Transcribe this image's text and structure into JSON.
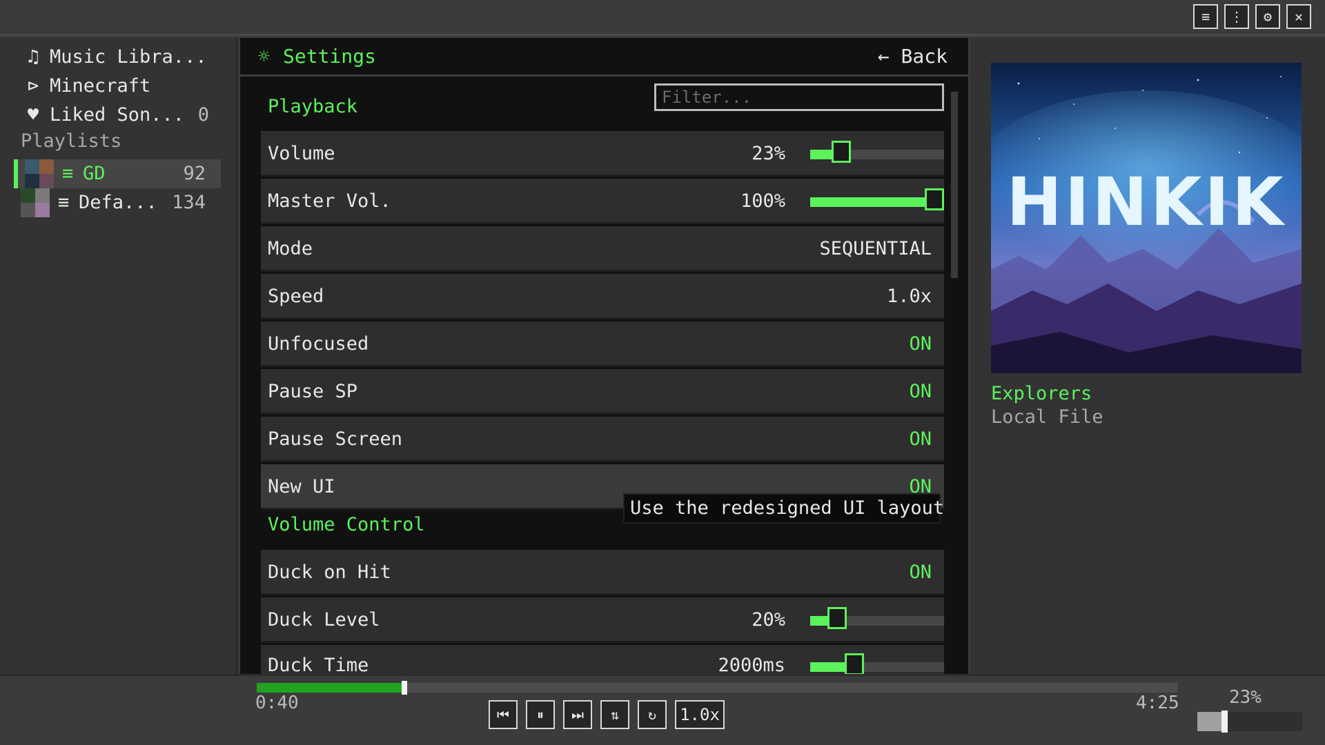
{
  "sidebar": {
    "items": [
      {
        "icon": "♫",
        "label": "Music Libra...",
        "count": ""
      },
      {
        "icon": "⊳",
        "label": "Minecraft",
        "count": ""
      },
      {
        "icon": "♥",
        "label": "Liked Son...",
        "count": "0"
      }
    ],
    "playlists_heading": "Playlists",
    "playlists": [
      {
        "icon": "≡",
        "label": "GD",
        "count": "92",
        "selected": true
      },
      {
        "icon": "≡",
        "label": "Defa...",
        "count": "134",
        "selected": false
      }
    ]
  },
  "settings": {
    "icon": "☼",
    "title": "Settings",
    "back_label": "← Back",
    "filter_placeholder": "Filter...",
    "sections": [
      {
        "title": "Playback",
        "rows": [
          {
            "label": "Volume",
            "value": "23%",
            "slider": 0.23
          },
          {
            "label": "Master Vol.",
            "value": "100%",
            "slider": 1.0
          },
          {
            "label": "Mode",
            "value": "SEQUENTIAL"
          },
          {
            "label": "Speed",
            "value": "1.0x"
          },
          {
            "label": "Unfocused",
            "value": "ON",
            "toggle": true
          },
          {
            "label": "Pause SP",
            "value": "ON",
            "toggle": true
          },
          {
            "label": "Pause Screen",
            "value": "ON",
            "toggle": true
          },
          {
            "label": "New UI",
            "value": "ON",
            "toggle": true
          }
        ]
      },
      {
        "title": "Volume Control",
        "rows": [
          {
            "label": "Duck on Hit",
            "value": "ON",
            "toggle": true
          },
          {
            "label": "Duck Level",
            "value": "20%",
            "slider": 0.2
          },
          {
            "label": "Duck Time",
            "value": "2000ms",
            "slider": 0.33
          }
        ]
      }
    ],
    "tooltip": "Use the redesigned UI layout"
  },
  "now_playing": {
    "art_text": "HINKIK",
    "title": "Explorers",
    "source": "Local File"
  },
  "player": {
    "elapsed": "0:40",
    "duration": "4:25",
    "progress": 0.157,
    "controls": {
      "prev": "⏮",
      "pause": "⏸",
      "next": "⏭",
      "shuffle": "⇅",
      "repeat": "↻",
      "speed": "1.0x"
    },
    "volume_label": "23%",
    "volume": 0.23
  },
  "topbar": {
    "icons": [
      "≡",
      "⋮",
      "⚙",
      "✕"
    ]
  },
  "colors": {
    "accent": "#5cf25c",
    "progress": "#21a321",
    "panel": "#333333",
    "settings_bg": "#111111"
  }
}
